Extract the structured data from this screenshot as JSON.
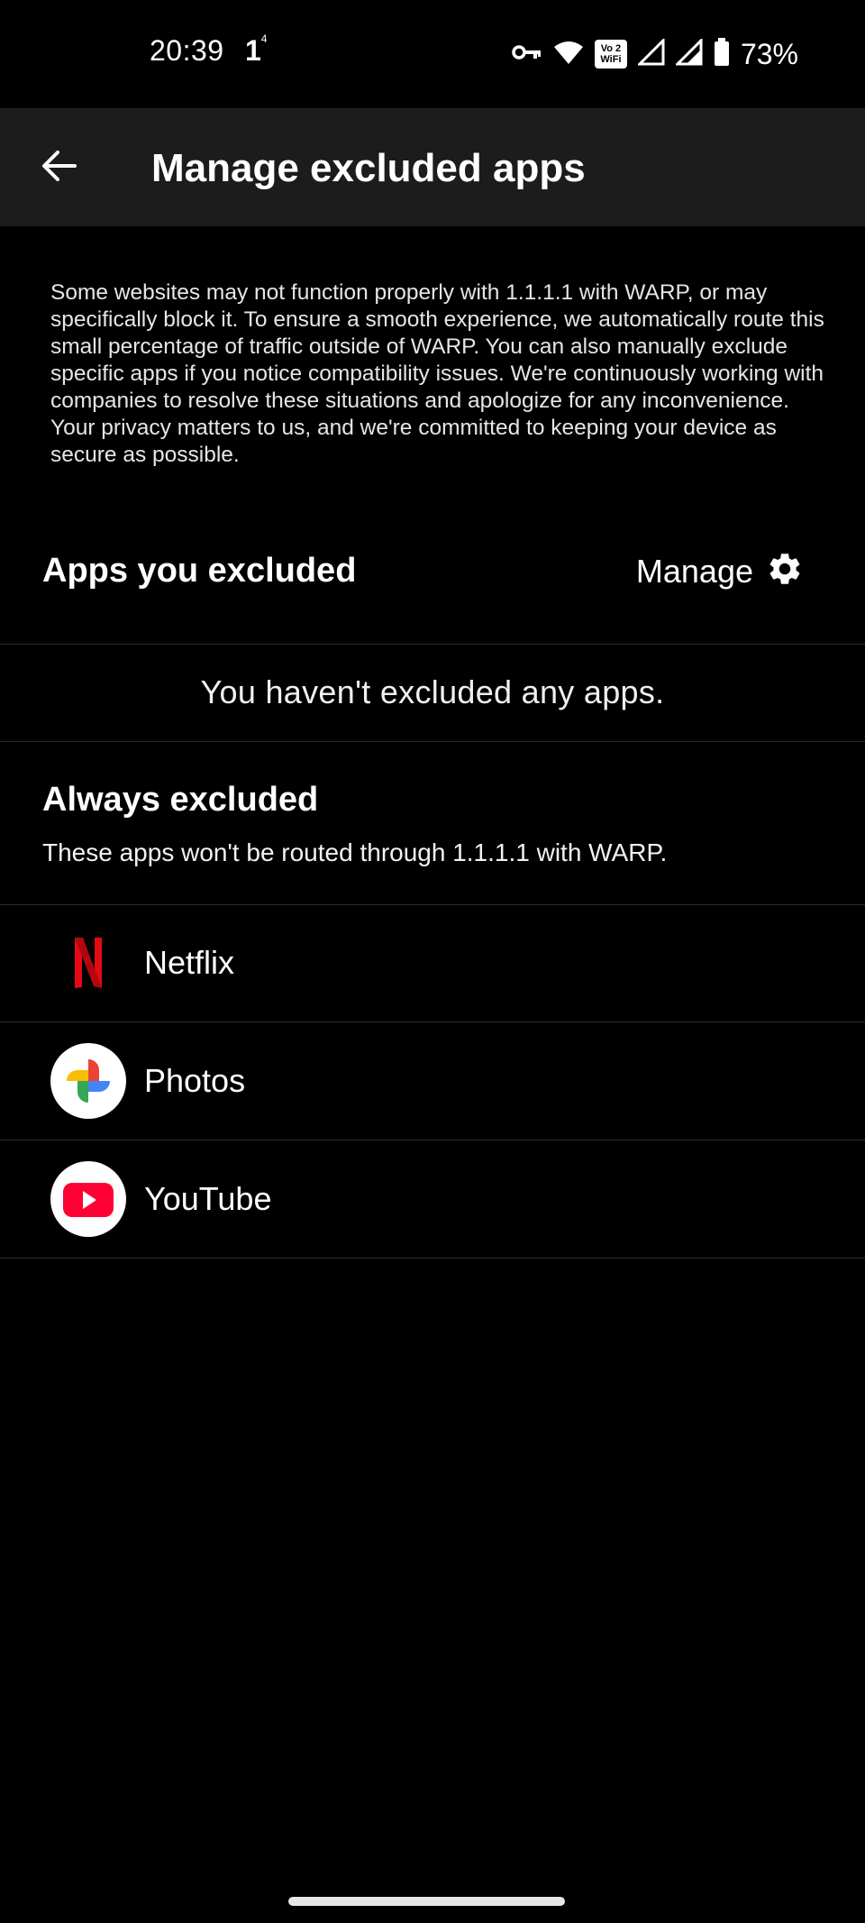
{
  "status_bar": {
    "time": "20:39",
    "notification": "1",
    "notification_sup": "4",
    "vowifi_top": "Vo 2",
    "vowifi_bottom": "WiFi",
    "battery_pct": "73%"
  },
  "app_bar": {
    "title": "Manage excluded apps"
  },
  "description": "Some websites may not function properly with 1.1.1.1 with WARP, or may specifically block it. To ensure a smooth experience, we automatically route this small percentage of traffic outside of WARP. You can also manually exclude specific apps if you notice compatibility issues. We're continuously working with companies to resolve these situations and apologize for any inconvenience. Your privacy matters to us, and we're committed to keeping your device as secure as possible.",
  "excluded_section": {
    "title": "Apps you excluded",
    "manage_label": "Manage",
    "empty_text": "You haven't excluded any apps."
  },
  "always_section": {
    "title": "Always excluded",
    "subtitle": "These apps won't be routed through 1.1.1.1 with WARP."
  },
  "apps": [
    {
      "name": "Netflix",
      "icon": "netflix-icon"
    },
    {
      "name": "Photos",
      "icon": "google-photos-icon"
    },
    {
      "name": "YouTube",
      "icon": "youtube-icon"
    }
  ],
  "colors": {
    "background": "#000000",
    "app_bar": "#1c1c1c",
    "netflix_red": "#e50914",
    "youtube_red": "#ff0033"
  }
}
